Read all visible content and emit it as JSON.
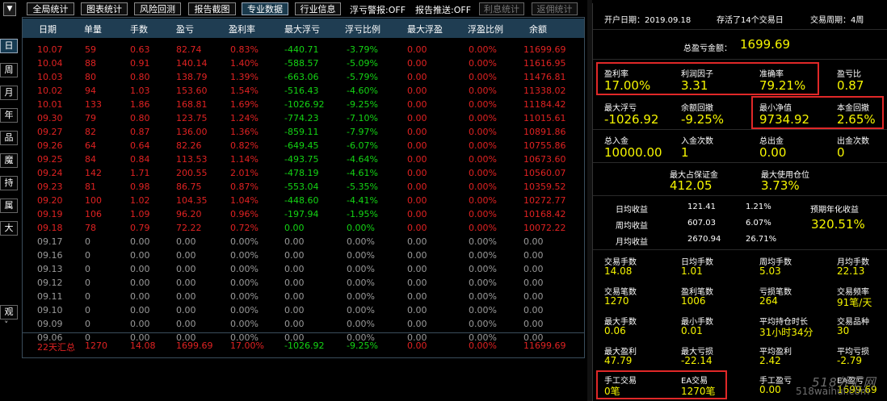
{
  "toolbar": {
    "dropdown_glyph": "▼",
    "buttons": [
      "全局统计",
      "图表统计",
      "风险回测",
      "报告截图",
      "专业数据",
      "行业信息"
    ],
    "float_alert": "浮亏警报:OFF",
    "report_push": "报告推送:OFF",
    "interest_btn": "利息统计",
    "rebate_btn": "返佣统计"
  },
  "sidebar": {
    "items": [
      "日",
      "周",
      "月",
      "年",
      "品种",
      "魔号",
      "持仓",
      "属性",
      "大字"
    ],
    "bottom": "观摩",
    "scroll_glyph": "˅"
  },
  "table": {
    "headers": [
      "日期",
      "单量",
      "手数",
      "盈亏",
      "盈利率",
      "最大浮亏",
      "浮亏比例",
      "最大浮盈",
      "浮盈比例",
      "余额"
    ],
    "rows": [
      [
        "10.07",
        "59",
        "0.63",
        "82.74",
        "0.83%",
        "-440.71",
        "-3.79%",
        "0.00",
        "0.00%",
        "11699.69"
      ],
      [
        "10.04",
        "88",
        "0.91",
        "140.14",
        "1.40%",
        "-588.57",
        "-5.09%",
        "0.00",
        "0.00%",
        "11616.95"
      ],
      [
        "10.03",
        "80",
        "0.80",
        "138.79",
        "1.39%",
        "-663.06",
        "-5.79%",
        "0.00",
        "0.00%",
        "11476.81"
      ],
      [
        "10.02",
        "94",
        "1.03",
        "153.60",
        "1.54%",
        "-516.43",
        "-4.60%",
        "0.00",
        "0.00%",
        "11338.02"
      ],
      [
        "10.01",
        "133",
        "1.86",
        "168.81",
        "1.69%",
        "-1026.92",
        "-9.25%",
        "0.00",
        "0.00%",
        "11184.42"
      ],
      [
        "09.30",
        "79",
        "0.80",
        "123.75",
        "1.24%",
        "-774.23",
        "-7.10%",
        "0.00",
        "0.00%",
        "11015.61"
      ],
      [
        "09.27",
        "82",
        "0.87",
        "136.00",
        "1.36%",
        "-859.11",
        "-7.97%",
        "0.00",
        "0.00%",
        "10891.86"
      ],
      [
        "09.26",
        "64",
        "0.64",
        "82.26",
        "0.82%",
        "-649.45",
        "-6.07%",
        "0.00",
        "0.00%",
        "10755.86"
      ],
      [
        "09.25",
        "84",
        "0.84",
        "113.53",
        "1.14%",
        "-493.75",
        "-4.64%",
        "0.00",
        "0.00%",
        "10673.60"
      ],
      [
        "09.24",
        "142",
        "1.71",
        "200.55",
        "2.01%",
        "-478.19",
        "-4.61%",
        "0.00",
        "0.00%",
        "10560.07"
      ],
      [
        "09.23",
        "81",
        "0.98",
        "86.75",
        "0.87%",
        "-553.04",
        "-5.35%",
        "0.00",
        "0.00%",
        "10359.52"
      ],
      [
        "09.20",
        "100",
        "1.02",
        "104.35",
        "1.04%",
        "-448.60",
        "-4.41%",
        "0.00",
        "0.00%",
        "10272.77"
      ],
      [
        "09.19",
        "106",
        "1.09",
        "96.20",
        "0.96%",
        "-197.94",
        "-1.95%",
        "0.00",
        "0.00%",
        "10168.42"
      ],
      [
        "09.18",
        "78",
        "0.79",
        "72.22",
        "0.72%",
        "0.00",
        "0.00%",
        "0.00",
        "0.00%",
        "10072.22"
      ],
      [
        "09.17",
        "0",
        "0.00",
        "0.00",
        "0.00%",
        "0.00",
        "0.00%",
        "0.00",
        "0.00%",
        "0.00"
      ],
      [
        "09.16",
        "0",
        "0.00",
        "0.00",
        "0.00%",
        "0.00",
        "0.00%",
        "0.00",
        "0.00%",
        "0.00"
      ],
      [
        "09.13",
        "0",
        "0.00",
        "0.00",
        "0.00%",
        "0.00",
        "0.00%",
        "0.00",
        "0.00%",
        "0.00"
      ],
      [
        "09.12",
        "0",
        "0.00",
        "0.00",
        "0.00%",
        "0.00",
        "0.00%",
        "0.00",
        "0.00%",
        "0.00"
      ],
      [
        "09.11",
        "0",
        "0.00",
        "0.00",
        "0.00%",
        "0.00",
        "0.00%",
        "0.00",
        "0.00%",
        "0.00"
      ],
      [
        "09.10",
        "0",
        "0.00",
        "0.00",
        "0.00%",
        "0.00",
        "0.00%",
        "0.00",
        "0.00%",
        "0.00"
      ],
      [
        "09.09",
        "0",
        "0.00",
        "0.00",
        "0.00%",
        "0.00",
        "0.00%",
        "0.00",
        "0.00%",
        "0.00"
      ],
      [
        "09.06",
        "0",
        "0.00",
        "0.00",
        "0.00%",
        "0.00",
        "0.00%",
        "0.00",
        "0.00%",
        "0.00"
      ]
    ],
    "summary": [
      "22天汇总",
      "1270",
      "14.08",
      "1699.69",
      "17.00%",
      "-1026.92",
      "-9.25%",
      "0.00",
      "0.00%",
      "11699.69"
    ]
  },
  "stats": {
    "open_date_label": "开户日期：2019.09.18",
    "survived": "存活了14个交易日",
    "cycle": "交易周期：4周",
    "total_label": "总盈亏金额：",
    "total_value": "1699.69",
    "profit_rate_label": "盈利率",
    "profit_rate": "17.00%",
    "profit_factor_label": "利润因子",
    "profit_factor": "3.31",
    "accuracy_label": "准确率",
    "accuracy": "79.21%",
    "pl_ratio_label": "盈亏比",
    "pl_ratio": "0.87",
    "max_float_loss_label": "最大浮亏",
    "max_float_loss": "-1026.92",
    "balance_drawdown_label": "余额回撤",
    "balance_drawdown": "-9.25%",
    "min_equity_label": "最小净值",
    "min_equity": "9734.92",
    "principal_drawdown_label": "本金回撤",
    "principal_drawdown": "2.65%",
    "deposit_label": "总入金",
    "deposit": "10000.00",
    "deposit_count_label": "入金次数",
    "deposit_count": "1",
    "withdraw_label": "总出金",
    "withdraw": "0.00",
    "withdraw_count_label": "出金次数",
    "withdraw_count": "0",
    "max_margin_label": "最大占保证金",
    "max_margin": "412.05",
    "max_position_label": "最大使用仓位",
    "max_position": "3.73%",
    "daily_label": "日均收益",
    "daily_value": "121.41",
    "daily_pct": "1.21%",
    "weekly_label": "周均收益",
    "weekly_value": "607.03",
    "weekly_pct": "6.07%",
    "monthly_label": "月均收益",
    "monthly_value": "2670.94",
    "monthly_pct": "26.71%",
    "annual_label": "预期年化收益",
    "annual_value": "320.51%",
    "grid": [
      {
        "label": "交易手数",
        "value": "14.08"
      },
      {
        "label": "日均手数",
        "value": "1.01"
      },
      {
        "label": "周均手数",
        "value": "5.03"
      },
      {
        "label": "月均手数",
        "value": "22.13"
      },
      {
        "label": "交易笔数",
        "value": "1270"
      },
      {
        "label": "盈利笔数",
        "value": "1006"
      },
      {
        "label": "亏损笔数",
        "value": "264"
      },
      {
        "label": "交易频率",
        "value": "91笔/天"
      },
      {
        "label": "最大手数",
        "value": "0.06"
      },
      {
        "label": "最小手数",
        "value": "0.01"
      },
      {
        "label": "平均持仓时长",
        "value": "31小时34分"
      },
      {
        "label": "交易品种",
        "value": "30"
      },
      {
        "label": "最大盈利",
        "value": "47.79"
      },
      {
        "label": "最大亏损",
        "value": "-22.14"
      },
      {
        "label": "平均盈利",
        "value": "2.42"
      },
      {
        "label": "平均亏损",
        "value": "-2.79"
      },
      {
        "label": "手工交易",
        "value": "0笔"
      },
      {
        "label": "EA交易",
        "value": "1270笔"
      },
      {
        "label": "手工盈亏",
        "value": "0.00"
      },
      {
        "label": "EA盈亏",
        "value": "1699.69"
      }
    ]
  },
  "watermark": {
    "line1": "518外汇网",
    "line2": "518waihui.com"
  },
  "colors": {
    "profit": "#e02222",
    "loss": "#14d414",
    "neutral": "#9a9a9a",
    "value": "#f5f500",
    "header_bg": "#1f3d52",
    "highlight_box": "#e02828"
  }
}
